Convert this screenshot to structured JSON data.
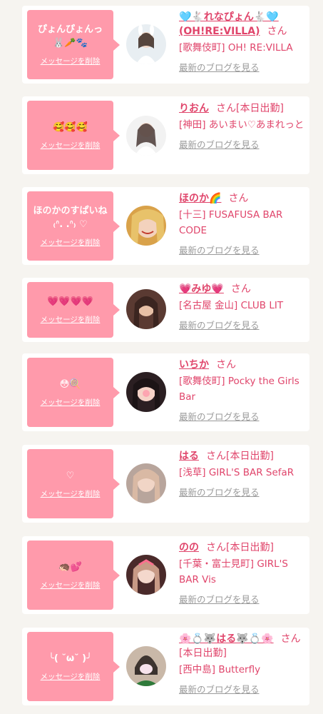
{
  "colors": {
    "accent": "#e0456b",
    "bubble": "#ff9aab",
    "background": "#f6f4f0",
    "link_gray": "#9a9a9a"
  },
  "common": {
    "delete_label": "メッセージを削除",
    "blog_label": "最新のブログを見る",
    "san": "さん"
  },
  "entries": [
    {
      "message": "ぴょんぴょんっ 🐰🥕🐾",
      "name": "🩵🐇れなぴょん🐇🩵 (OH!RE:VILLA)",
      "status": "",
      "shop": "[歌舞伎町] OH! RE:VILLA"
    },
    {
      "message": "🥰🥰🥰",
      "name": "りおん",
      "status": "[本日出勤]",
      "shop": "[神田] あいまい♡あまれっと"
    },
    {
      "message": "ほのかのすぱいね ₍ᐢ. .ᐢ₎ ♡",
      "name": "ほのか🌈",
      "status": "",
      "shop": "[十三] FUSAFUSA BAR CODE"
    },
    {
      "message": "💗💗💗💗",
      "name": "💗みゆ💗",
      "status": "",
      "shop": "[名古屋 金山] CLUB LIT"
    },
    {
      "message": "😳🍭",
      "name": "いちか",
      "status": "",
      "shop": "[歌舞伎町] Pocky the Girls Bar"
    },
    {
      "message": "♡",
      "name": "はる",
      "status": "[本日出勤]",
      "shop": "[浅草] GIRL'S BAR SefaR"
    },
    {
      "message": "🦔💕",
      "name": "のの",
      "status": "[本日出勤]",
      "shop": "[千葉・富士見町] GIRL'S BAR Vis"
    },
    {
      "message": "╰( ˘ω˘ )╯",
      "name": "🌸💍🐺はる🐺💍🌸",
      "status": "[本日出勤]",
      "shop": "[西中島] Butterfly"
    }
  ]
}
